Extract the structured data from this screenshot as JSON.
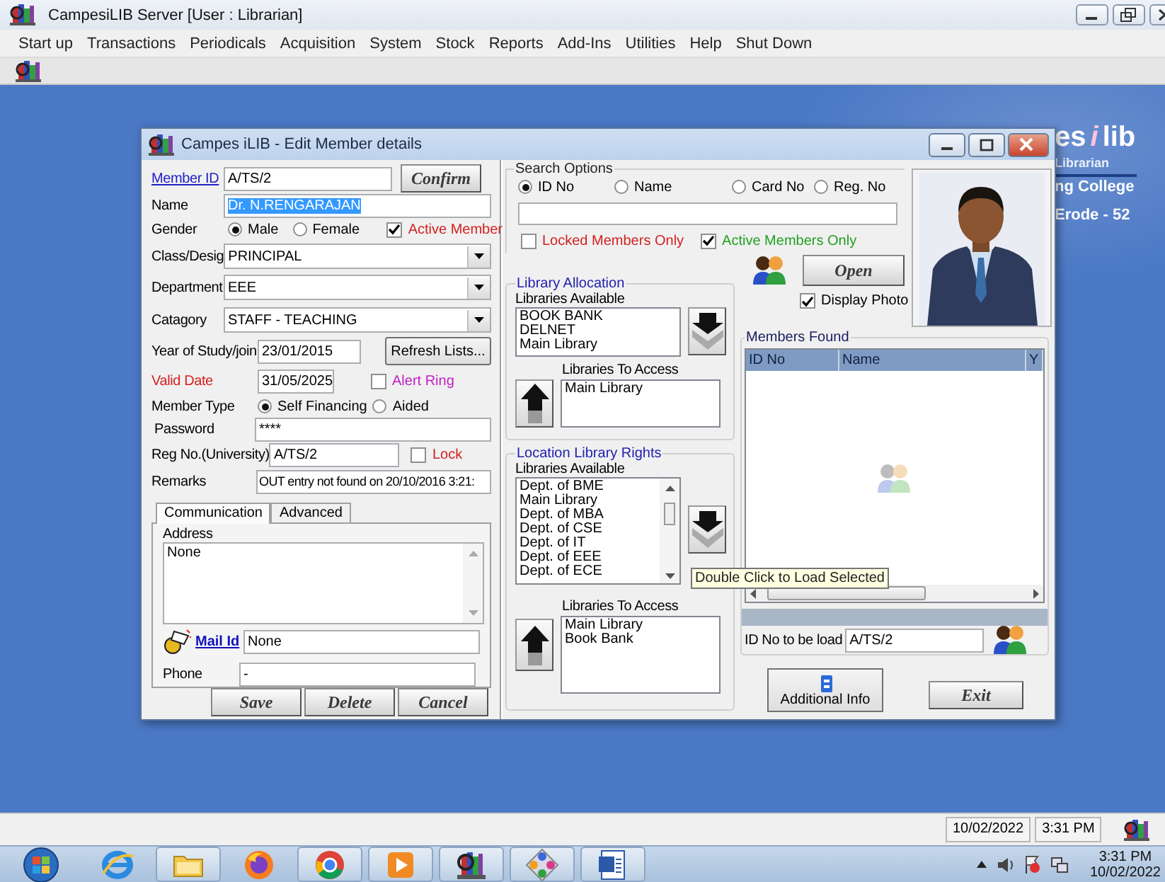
{
  "app": {
    "title": "CampesiLIB Server [User : Librarian]",
    "menu": [
      "Start up",
      "Transactions",
      "Periodicals",
      "Acquisition",
      "System",
      "Stock",
      "Reports",
      "Add-Ins",
      "Utilities",
      "Help",
      "Shut Down"
    ]
  },
  "desktop": {
    "logo": {
      "text": "es",
      "accent": "i",
      "suffix": "lib"
    },
    "lines": [
      "Librarian",
      "ng College",
      "Erode - 52"
    ]
  },
  "dialog": {
    "title": "Campes iLIB - Edit Member details",
    "member_id": {
      "label": "Member ID",
      "value": "A/TS/2"
    },
    "confirm_button": "Confirm",
    "name": {
      "label": "Name",
      "value": "Dr. N.RENGARAJAN",
      "selected": true
    },
    "gender": {
      "label": "Gender",
      "options": [
        {
          "label": "Male",
          "selected": true
        },
        {
          "label": "Female",
          "selected": false
        }
      ]
    },
    "active_member": {
      "label": "Active Member",
      "checked": true
    },
    "class_desig": {
      "label": "Class/Desig",
      "value": "PRINCIPAL"
    },
    "department": {
      "label": "Department",
      "value": "EEE"
    },
    "category": {
      "label": "Catagory",
      "value": "STAFF - TEACHING"
    },
    "year_of_study": {
      "label": "Year of Study/join",
      "value": "23/01/2015"
    },
    "refresh_button": "Refresh Lists...",
    "valid_date": {
      "label": "Valid Date",
      "value": "31/05/2025"
    },
    "alert_ring": {
      "label": "Alert Ring",
      "checked": false
    },
    "member_type": {
      "label": "Member Type",
      "options": [
        {
          "label": "Self Financing",
          "selected": true
        },
        {
          "label": "Aided",
          "selected": false
        }
      ]
    },
    "password": {
      "label": "Password",
      "value": "****"
    },
    "reg_no": {
      "label": "Reg No.(University)",
      "value": "A/TS/2"
    },
    "lock": {
      "label": "Lock",
      "checked": false
    },
    "remarks": {
      "label": "Remarks",
      "value": "OUT entry not found on 20/10/2016 3:21:"
    },
    "tabs": [
      {
        "label": "Communication",
        "selected": true
      },
      {
        "label": "Advanced",
        "selected": false
      }
    ],
    "address": {
      "label": "Address",
      "value": "None"
    },
    "mail_id": {
      "label": "Mail Id",
      "value": "None"
    },
    "phone": {
      "label": "Phone",
      "value": "-"
    },
    "buttons": [
      "Save",
      "Delete",
      "Cancel"
    ],
    "search_options": {
      "title": "Search Options",
      "options": [
        {
          "label": "ID No",
          "selected": true
        },
        {
          "label": "Name",
          "selected": false
        },
        {
          "label": "Card No",
          "selected": false
        },
        {
          "label": "Reg. No",
          "selected": false
        }
      ],
      "locked_only": {
        "label": "Locked Members Only",
        "checked": false
      },
      "active_only": {
        "label": "Active Members Only",
        "checked": true
      }
    },
    "open_button": "Open",
    "display_photo": {
      "label": "Display Photo",
      "checked": true
    },
    "photo": {
      "kind": "picture"
    },
    "library_allocation": {
      "title": "Library Allocation",
      "available_label": "Libraries Available",
      "available": [
        "BOOK BANK",
        "DELNET",
        "Main Library"
      ],
      "access_label": "Libraries To Access",
      "access": [
        "Main Library"
      ]
    },
    "location_rights": {
      "title": "Location Library Rights",
      "available_label": "Libraries Available",
      "available": [
        "Dept. of BME",
        "Main Library",
        "Dept. of MBA",
        "Dept. of CSE",
        "Dept. of IT",
        "Dept. of EEE",
        "Dept. of ECE"
      ],
      "access_label": "Libraries To Access",
      "access": [
        "Main Library",
        "Book Bank"
      ]
    },
    "members_found": {
      "title": "Members Found",
      "columns": [
        "ID No",
        "Name",
        "Y"
      ],
      "load_label": "ID No to be load",
      "load_value": "A/TS/2"
    },
    "tooltip": "Double Click to Load Selected",
    "additional_info_button": "Additional Info",
    "exit_button": "Exit"
  },
  "status_bar": {
    "date": "10/02/2022",
    "time": "3:31 PM"
  },
  "taskbar": {
    "apps": [
      {
        "kind": "ie",
        "running": false
      },
      {
        "kind": "folder",
        "running": true
      },
      {
        "kind": "firefox",
        "running": false
      },
      {
        "kind": "chrome",
        "running": true
      },
      {
        "kind": "media",
        "running": true
      },
      {
        "kind": "campes",
        "running": true
      },
      {
        "kind": "diamond",
        "running": true
      },
      {
        "kind": "word",
        "running": true
      }
    ],
    "time": "3:31 PM",
    "date": "10/02/2022"
  }
}
